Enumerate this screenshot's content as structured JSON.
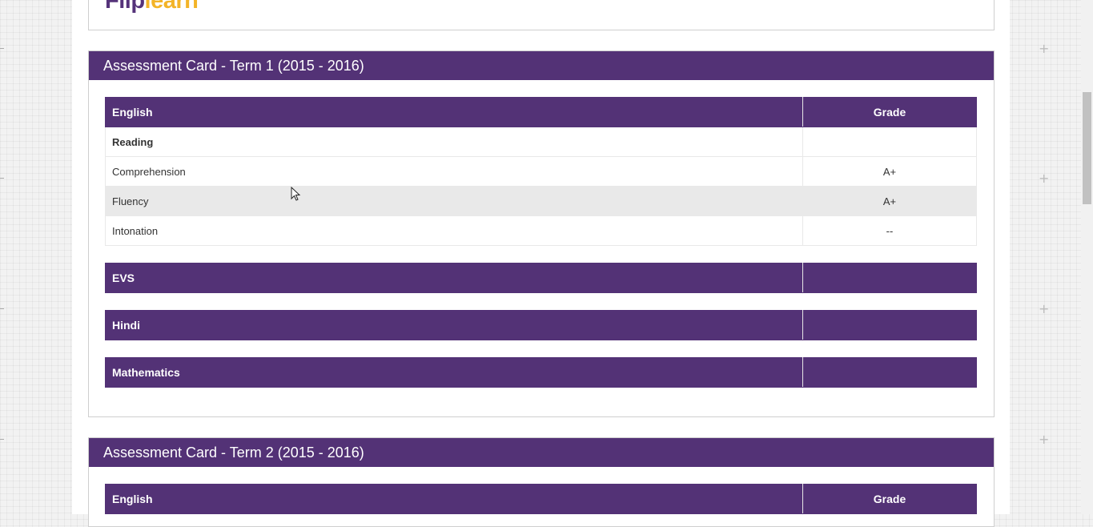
{
  "logo": {
    "part1": "Flip",
    "part2": "learn"
  },
  "term1": {
    "title": "Assessment Card - Term 1 (2015 - 2016)",
    "english": {
      "subject": "English",
      "grade_header": "Grade",
      "rows": [
        {
          "name": "Reading",
          "grade": ""
        },
        {
          "name": "Comprehension",
          "grade": "A+"
        },
        {
          "name": "Fluency",
          "grade": "A+"
        },
        {
          "name": "Intonation",
          "grade": "--"
        }
      ]
    },
    "evs": {
      "subject": "EVS"
    },
    "hindi": {
      "subject": "Hindi"
    },
    "maths": {
      "subject": "Mathematics"
    }
  },
  "term2": {
    "title": "Assessment Card - Term 2 (2015 - 2016)",
    "english": {
      "subject": "English",
      "grade_header": "Grade"
    }
  },
  "colors": {
    "header_purple": "#533276",
    "logo_yellow": "#f3b428",
    "row_alt": "#e9e9e9"
  },
  "icons": [
    "plus-icon",
    "mouse-cursor-icon"
  ]
}
